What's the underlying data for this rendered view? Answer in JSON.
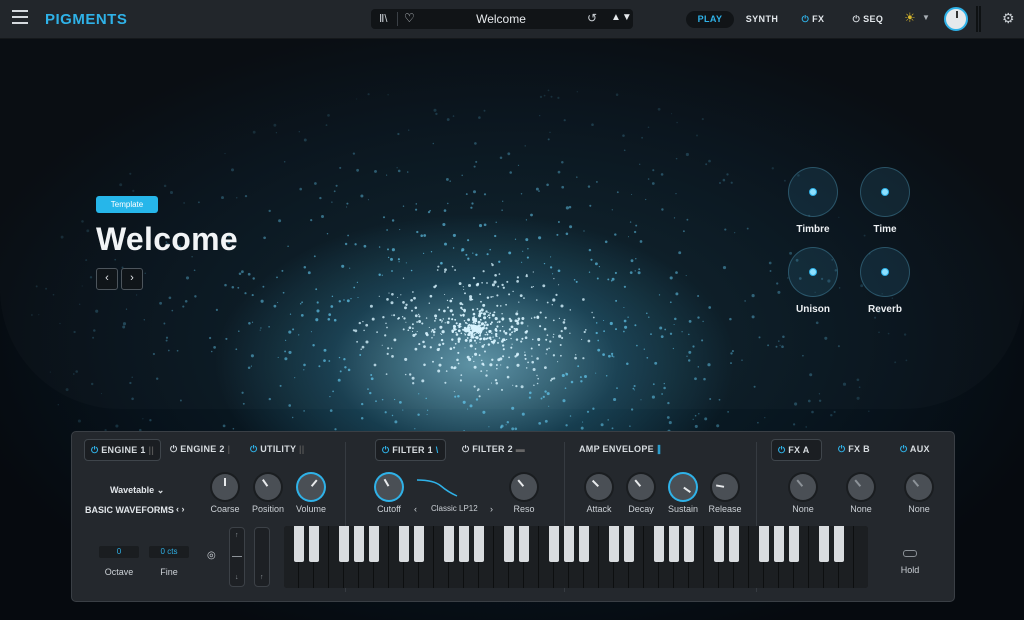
{
  "app": {
    "name": "PIGMENTS"
  },
  "preset": {
    "name": "Welcome",
    "tag": "Template"
  },
  "nav": {
    "play": "PLAY",
    "synth": "SYNTH",
    "fx": "FX",
    "seq": "SEQ"
  },
  "icons": {
    "menu": "hamburger-icon",
    "library": "library-icon",
    "favorite": "heart-icon",
    "refresh": "refresh-icon",
    "browse": "up-down-arrows-icon",
    "power": "power-icon",
    "idea": "lightbulb-icon",
    "settings": "gear-icon"
  },
  "colors": {
    "accent": "#2fb2e8",
    "panel": "#24282d",
    "topbar": "#22262b",
    "bulb": "#d8b72c"
  },
  "macros": [
    {
      "label": "Timbre"
    },
    {
      "label": "Time"
    },
    {
      "label": "Unison"
    },
    {
      "label": "Reverb"
    }
  ],
  "engine": {
    "tab1": "ENGINE 1",
    "tab2": "ENGINE 2",
    "tab3": "UTILITY",
    "type": "Wavetable",
    "waveform": "BASIC WAVEFORMS",
    "knobs": [
      "Coarse",
      "Position",
      "Volume"
    ]
  },
  "filter": {
    "tab1": "FILTER 1",
    "tab2": "FILTER 2",
    "cutoff": "Cutoff",
    "type": "Classic LP12",
    "reso": "Reso"
  },
  "amp": {
    "title": "AMP ENVELOPE",
    "knobs": [
      "Attack",
      "Decay",
      "Sustain",
      "Release"
    ]
  },
  "fx": {
    "tabs": [
      "FX A",
      "FX B",
      "AUX"
    ],
    "slots": [
      "None",
      "None",
      "None"
    ]
  },
  "play": {
    "octave_value": "0",
    "octave_label": "Octave",
    "fine_value": "0 cts",
    "fine_label": "Fine",
    "hold": "Hold"
  }
}
